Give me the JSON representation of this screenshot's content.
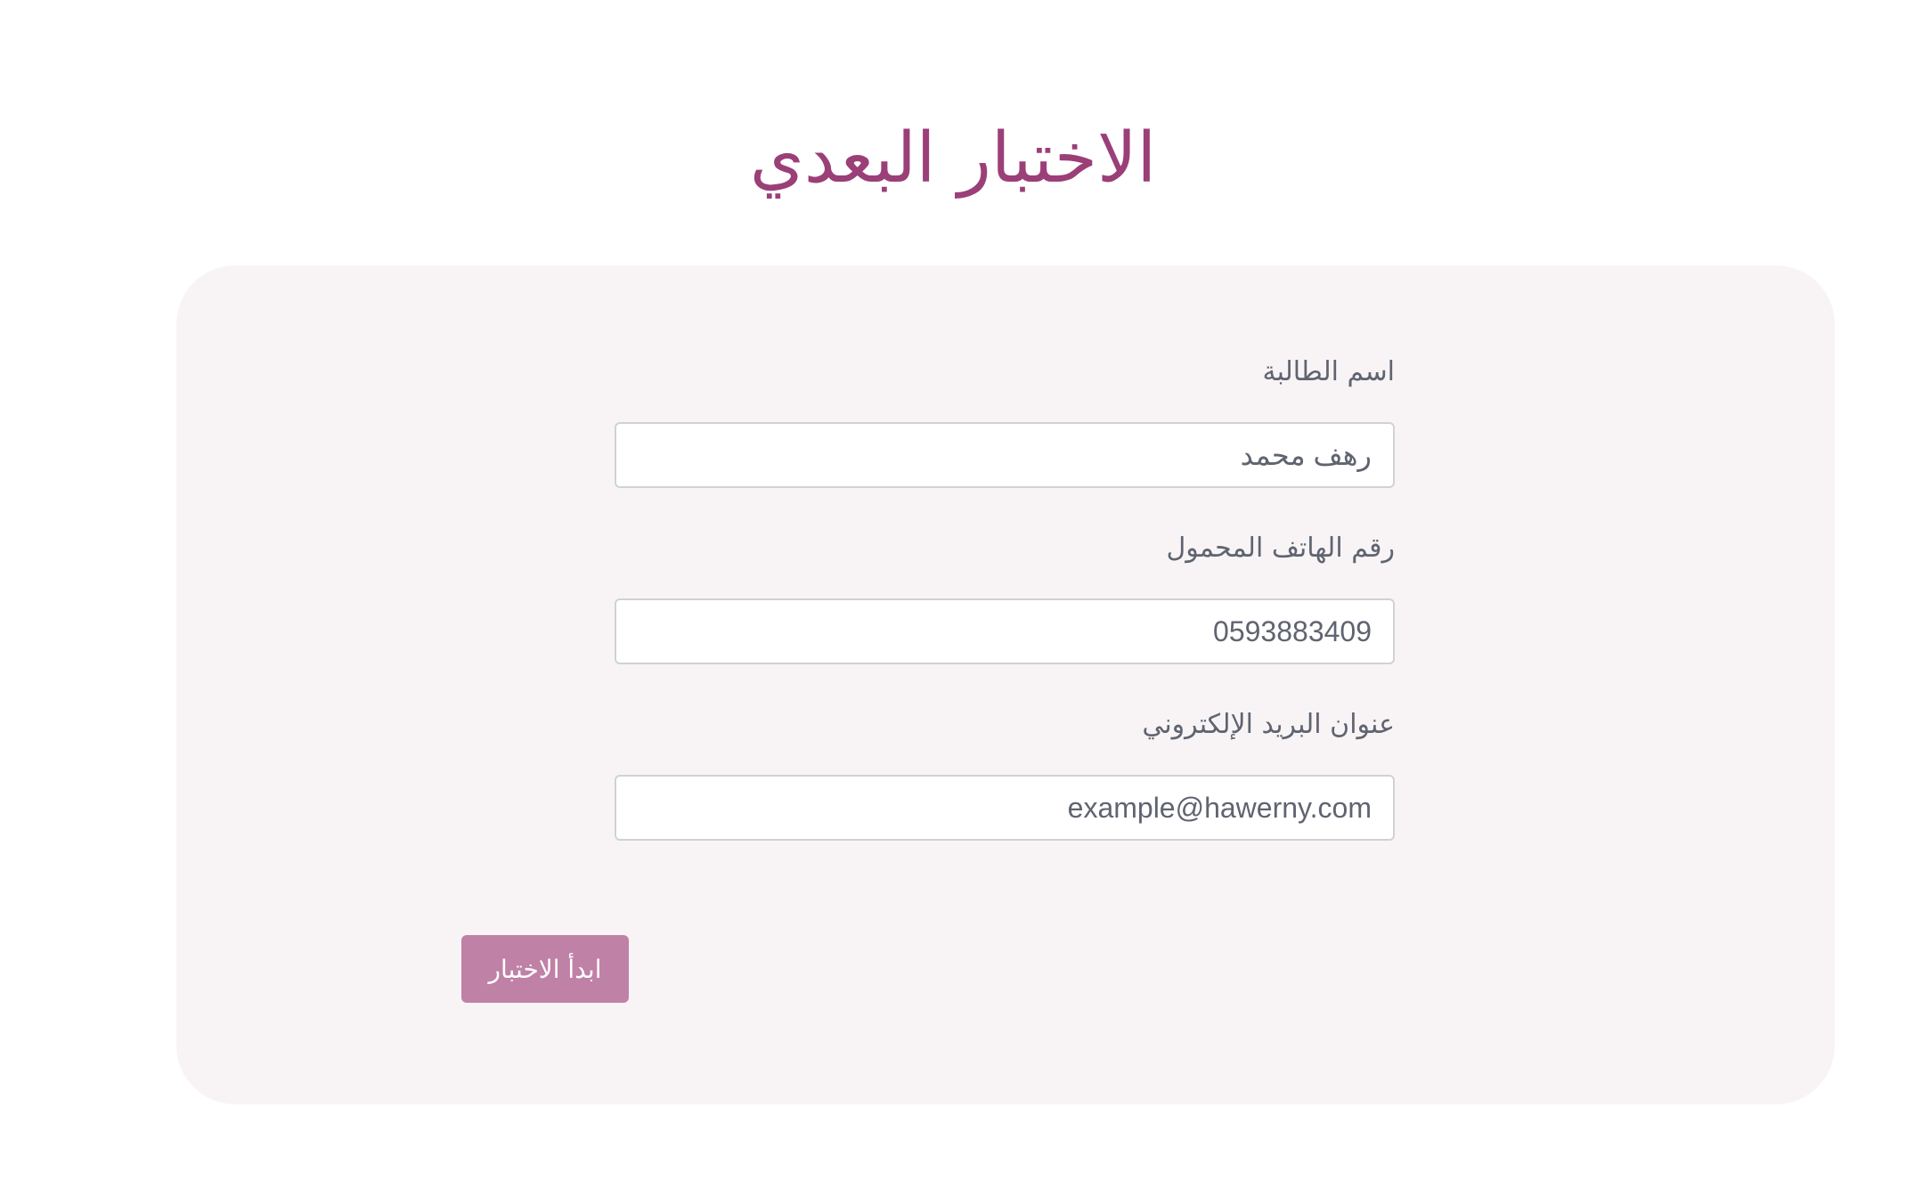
{
  "page": {
    "title": "الاختبار البعدي"
  },
  "form": {
    "fields": [
      {
        "label": "اسم الطالبة",
        "value": "رهف محمد"
      },
      {
        "label": "رقم الهاتف المحمول",
        "value": "0593883409"
      },
      {
        "label": "عنوان البريد الإلكتروني",
        "value": "example@hawerny.com"
      }
    ],
    "submit_label": "ابدأ الاختبار"
  },
  "colors": {
    "title": "#9b3f78",
    "button": "#c081a6",
    "card_background": "#f8f4f6"
  }
}
